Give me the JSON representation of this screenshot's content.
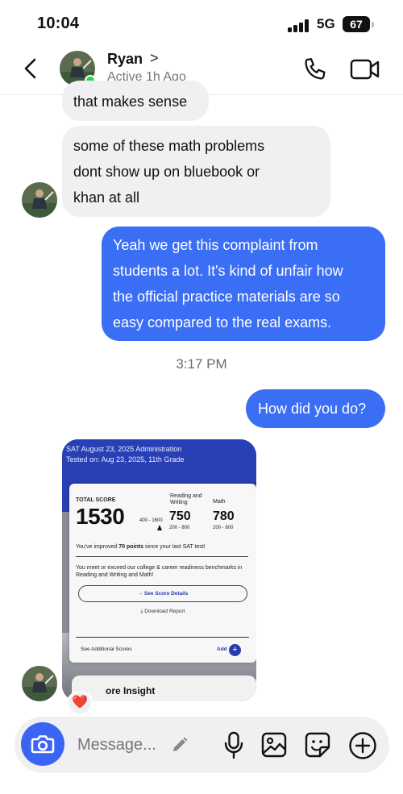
{
  "status_bar": {
    "time": "10:04",
    "network": "5G",
    "battery": "67"
  },
  "header": {
    "contact_name": "Ryan",
    "name_chevron": ">",
    "contact_status": "Active 1h Ago",
    "icons": [
      "back-icon",
      "avatar",
      "phone-icon",
      "video-camera-icon"
    ]
  },
  "messages": [
    {
      "from": "Ryan",
      "lines": [
        "that makes sense"
      ]
    },
    {
      "from": "Ryan",
      "lines": [
        "some of these math problems",
        "dont show up on bluebook or",
        "khan at all"
      ]
    },
    {
      "from": "me",
      "lines": [
        "Yeah we get this complaint from",
        "students a lot. It's kind of unfair how",
        "the official practice materials are so",
        "easy compared to the real exams."
      ]
    }
  ],
  "timestamp": "3:17 PM",
  "message_after_time": {
    "from": "me",
    "text": "How did you do?"
  },
  "photo_message": {
    "from": "Ryan",
    "reaction": "❤️",
    "content": {
      "admin_line1": "SAT August 23, 2025 Administration",
      "admin_line2": "Tested on: Aug 23, 2025, 11th Grade",
      "total_label": "TOTAL SCORE",
      "total_score": "1530",
      "total_range": "400 - 1600",
      "rw_label": "Reading and Writing",
      "rw_score": "750",
      "rw_range": "200 - 800",
      "math_label": "Math",
      "math_score": "780",
      "math_range": "200 - 800",
      "improvement_prefix": "You've improved ",
      "improvement_bold": "70 points",
      "improvement_suffix": " since your last SAT test!",
      "benchmark_text": "You meet or exceed our college & career readiness benchmarks in Reading and Writing and Math!",
      "score_details_btn": "→ See Score Details",
      "download_report": "⤓ Download Report",
      "additional_scores": "See Additional Scores",
      "add_label": "Add",
      "add_symbol": "+",
      "next_card_title": "ore Insight"
    }
  },
  "composer": {
    "placeholder": "Message...",
    "buttons": [
      "camera-icon",
      "microphone-icon",
      "gallery-icon",
      "sticker-icon",
      "plus-icon"
    ]
  }
}
